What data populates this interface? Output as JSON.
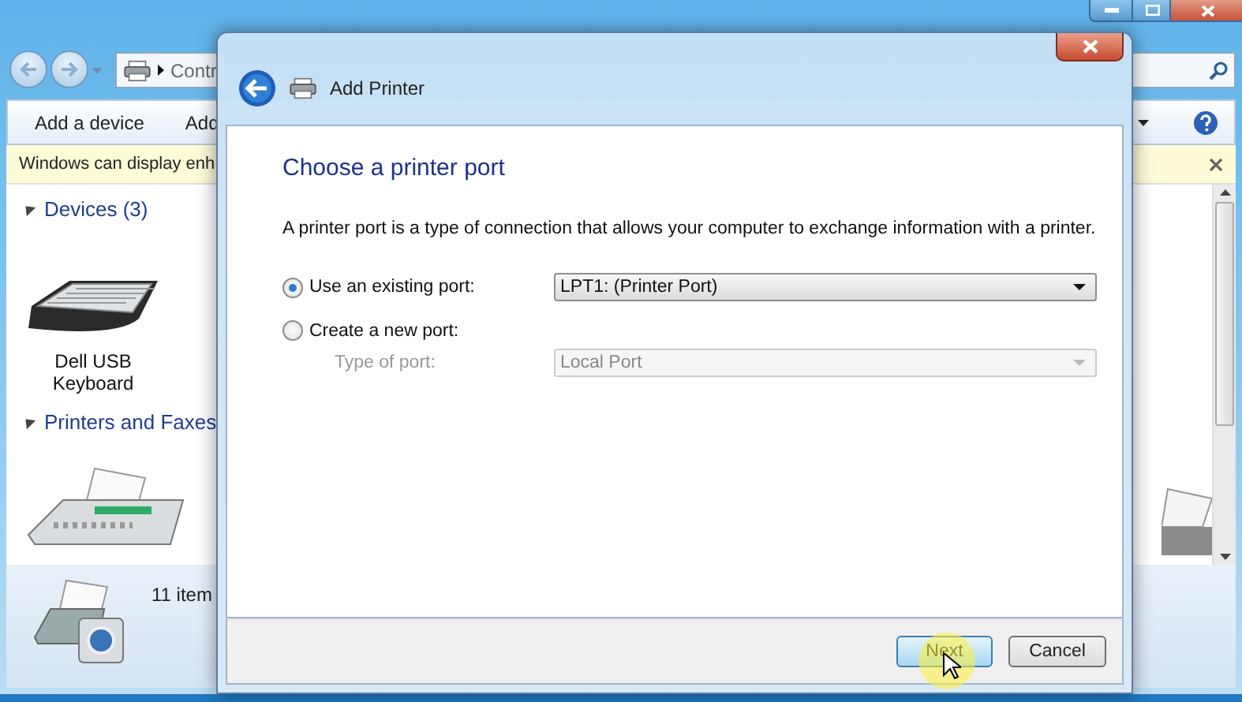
{
  "explorer": {
    "address": "Contr",
    "toolbar": [
      "Add a device",
      "Add"
    ],
    "info_bar": "Windows can display enh",
    "groups": [
      {
        "title": "Devices (3)",
        "expanded": true
      },
      {
        "title": "Printers and Faxes",
        "expanded": true
      }
    ],
    "device_label": "Dell USB Keyboard",
    "details": "11 item"
  },
  "dialog": {
    "title": "Add Printer",
    "heading": "Choose a printer port",
    "description": "A printer port is a type of connection that allows your computer to exchange information with a printer.",
    "port_options": [
      {
        "label": "Use an existing port:",
        "selected": true
      },
      {
        "label": "Create a new port:",
        "selected": false
      }
    ],
    "existing_port": {
      "value": "LPT1: (Printer Port)",
      "disabled": false
    },
    "port_type": {
      "label": "Type of port:",
      "value": "Local Port",
      "disabled": true
    },
    "buttons": [
      {
        "label": "Next",
        "kind": "primary"
      },
      {
        "label": "Cancel",
        "kind": "secondary"
      }
    ]
  }
}
